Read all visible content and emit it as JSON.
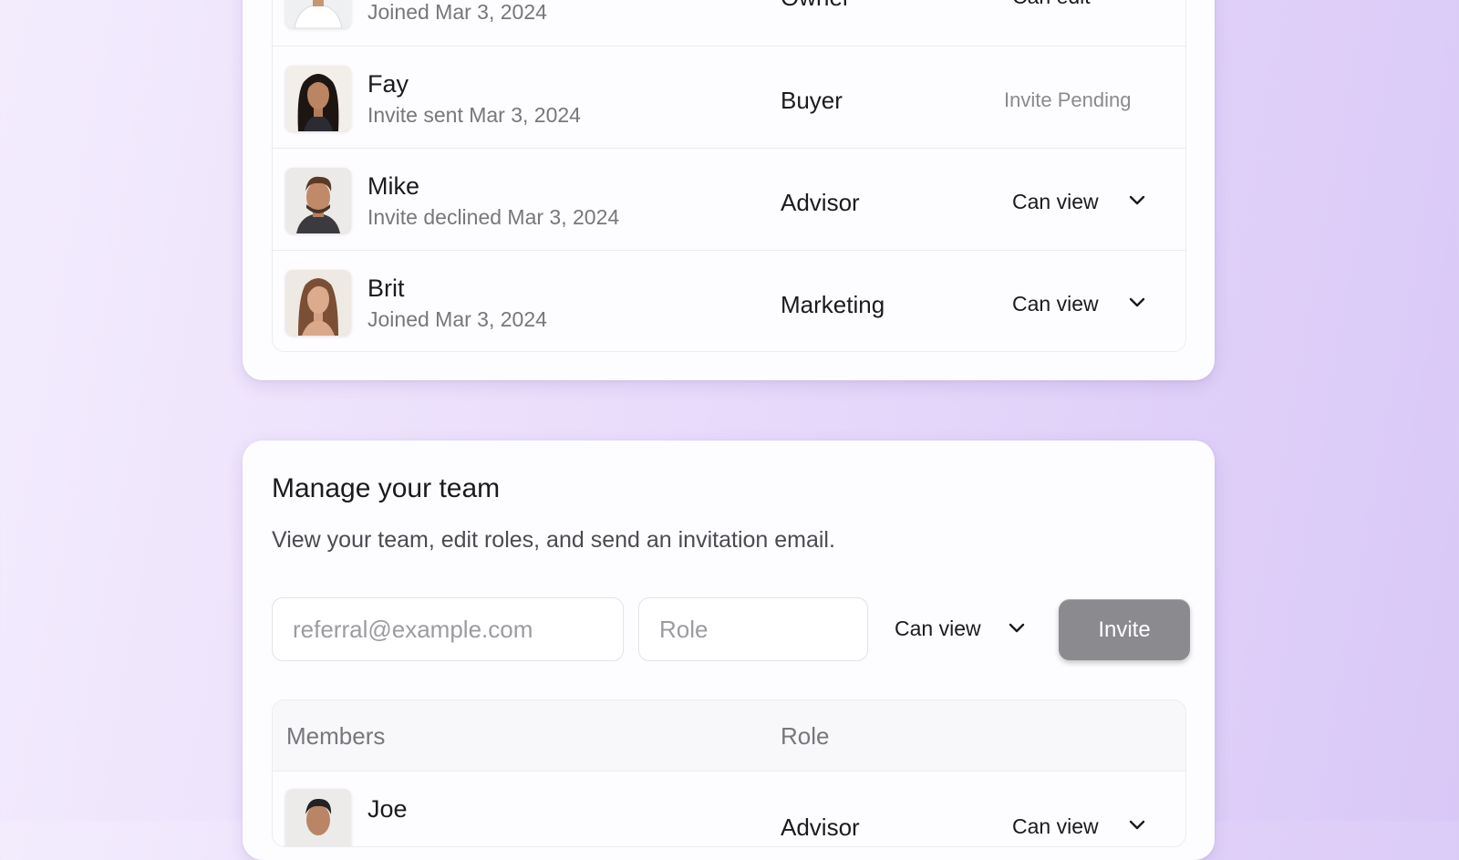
{
  "top_card": {
    "members": [
      {
        "name": "",
        "subtitle": "Joined Mar 3, 2024",
        "role": "Owner",
        "permission": "Can edit",
        "avatar_icon": "man-white-shirt-avatar",
        "has_dropdown": false
      },
      {
        "name": "Fay",
        "subtitle": "Invite sent Mar 3, 2024",
        "role": "Buyer",
        "permission": "Invite Pending",
        "avatar_icon": "woman-dark-hair-avatar",
        "has_dropdown": false
      },
      {
        "name": "Mike",
        "subtitle": "Invite declined Mar 3, 2024",
        "role": "Advisor",
        "permission": "Can view",
        "avatar_icon": "man-brown-hair-avatar",
        "has_dropdown": true
      },
      {
        "name": "Brit",
        "subtitle": "Joined Mar 3, 2024",
        "role": "Marketing",
        "permission": "Can view",
        "avatar_icon": "woman-auburn-hair-avatar",
        "has_dropdown": true
      }
    ]
  },
  "manage": {
    "title": "Manage your team",
    "description": "View your team, edit roles, and send an invitation email.",
    "email_placeholder": "referral@example.com",
    "role_placeholder": "Role",
    "permission": "Can view",
    "invite_label": "Invite",
    "table_headers": {
      "members": "Members",
      "role": "Role"
    },
    "members": [
      {
        "name": "Joe",
        "role": "Advisor",
        "permission": "Can view",
        "avatar_icon": "man-dark-hair-avatar"
      }
    ]
  },
  "colors": {
    "background": "#ece1fb",
    "card": "#fdfcfe",
    "invite_button": "#8a8a8f",
    "muted_text": "#77777c"
  }
}
